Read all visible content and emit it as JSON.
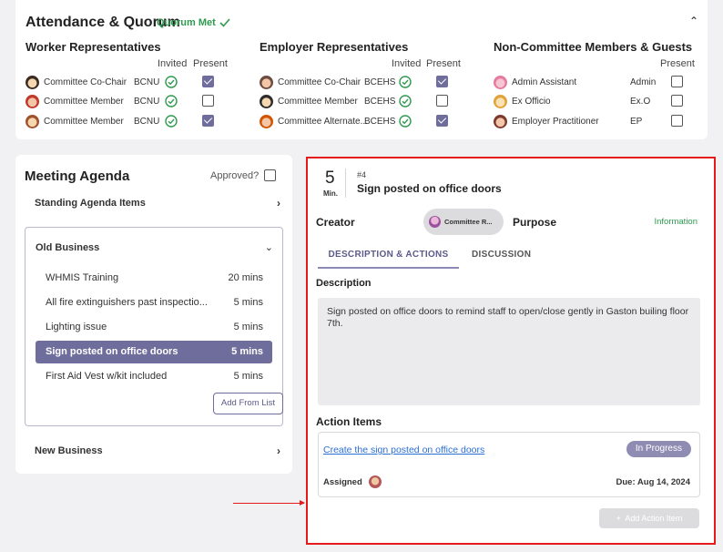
{
  "attendance": {
    "title": "Attendance & Quorum",
    "quorum_status": "Quorum Met",
    "groups": [
      {
        "title": "Worker Representatives",
        "col_invited": "Invited",
        "col_present": "Present",
        "members": [
          {
            "role": "Committee Co-Chair",
            "org": "BCNU",
            "invited": true,
            "present": true
          },
          {
            "role": "Committee Member",
            "org": "BCNU",
            "invited": true,
            "present": false
          },
          {
            "role": "Committee Member",
            "org": "BCNU",
            "invited": true,
            "present": true
          }
        ]
      },
      {
        "title": "Employer Representatives",
        "col_invited": "Invited",
        "col_present": "Present",
        "members": [
          {
            "role": "Committee Co-Chair",
            "org": "BCEHS",
            "invited": true,
            "present": true
          },
          {
            "role": "Committee Member",
            "org": "BCEHS",
            "invited": true,
            "present": false
          },
          {
            "role": "Committee Alternate...",
            "org": "BCEHS",
            "invited": true,
            "present": true
          }
        ]
      },
      {
        "title": "Non-Committee Members & Guests",
        "col_present": "Present",
        "members": [
          {
            "role": "Admin Assistant",
            "org": "Admin",
            "present": false
          },
          {
            "role": "Ex Officio",
            "org": "Ex.O",
            "present": false
          },
          {
            "role": "Employer Practitioner",
            "org": "EP",
            "present": false
          }
        ]
      }
    ]
  },
  "agenda": {
    "title": "Meeting Agenda",
    "approved_label": "Approved?",
    "standing_label": "Standing Agenda Items",
    "old_business": {
      "label": "Old Business",
      "items": [
        {
          "name": "WHMIS Training",
          "duration": "20 mins"
        },
        {
          "name": "All fire extinguishers past inspectio...",
          "duration": "5 mins"
        },
        {
          "name": "Lighting issue",
          "duration": "5 mins"
        },
        {
          "name": "Sign posted on office doors",
          "duration": "5 mins"
        },
        {
          "name": "First Aid Vest w/kit included",
          "duration": "5 mins"
        }
      ],
      "add_from_list": "Add From List"
    },
    "new_business_label": "New Business"
  },
  "detail": {
    "minutes": "5",
    "minutes_unit": "Min.",
    "item_number": "#4",
    "title": "Sign posted on office doors",
    "creator_label": "Creator",
    "creator_chip": "Committee R...",
    "purpose_label": "Purpose",
    "purpose_value": "Information",
    "tab_desc": "DESCRIPTION & ACTIONS",
    "tab_discussion": "DISCUSSION",
    "description_label": "Description",
    "description_text": "Sign posted on office doors to remind staff to open/close gently in Gaston builing floor 7th.",
    "action_items_label": "Action Items",
    "action": {
      "link": "Create the sign posted on office doors",
      "status": "In Progress",
      "assigned_label": "Assigned",
      "due": "Due: Aug 14, 2024"
    },
    "add_action_item": "Add Action Item"
  },
  "colors": {
    "accent": "#6f6d9c",
    "success": "#2e9a4e",
    "highlight_border": "#e31b1b",
    "link": "#2b6fd4"
  }
}
